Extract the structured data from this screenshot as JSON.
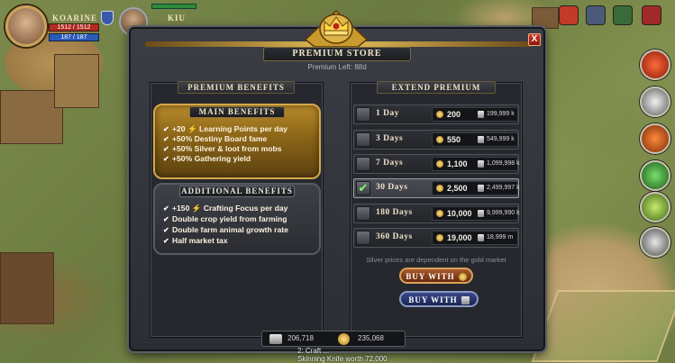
{
  "hud": {
    "player_name": "KOARINE",
    "health": "1512 / 1512",
    "energy": "187 / 187",
    "party_member": "KIU"
  },
  "window": {
    "title": "PREMIUM STORE",
    "premium_left": "Premium Left: 88d",
    "close_label": "X"
  },
  "benefits": {
    "header": "PREMIUM BENEFITS",
    "main_title": "MAIN BENEFITS",
    "main_items": [
      "+20 ⚡ Learning Points per day",
      "+50% Destiny Board fame",
      "+50% Silver & loot from mobs",
      "+50% Gathering yield"
    ],
    "additional_title": "ADDITIONAL BENEFITS",
    "additional_items": [
      "+150 ⚡ Crafting Focus per day",
      "Double crop yield from farming",
      "Double farm animal growth rate",
      "Half market tax"
    ]
  },
  "extend": {
    "header": "EXTEND PREMIUM",
    "packages": [
      {
        "days": "1 Day",
        "gold": "200",
        "silver": "199,999 k",
        "selected": false
      },
      {
        "days": "3 Days",
        "gold": "550",
        "silver": "549,999 k",
        "selected": false
      },
      {
        "days": "7 Days",
        "gold": "1,100",
        "silver": "1,099,998 k",
        "selected": false
      },
      {
        "days": "30 Days",
        "gold": "2,500",
        "silver": "2,499,997 k",
        "selected": true
      },
      {
        "days": "180 Days",
        "gold": "10,000",
        "silver": "9,999,990 k",
        "selected": false
      },
      {
        "days": "360 Days",
        "gold": "19,000",
        "silver": "18,999 m",
        "selected": false
      }
    ],
    "note": "Silver prices are dependent on the gold market",
    "buy_gold_label": "BUY WITH",
    "buy_silver_label": "BUY WITH"
  },
  "currency": {
    "silver": "206,718",
    "gold": "235,068"
  },
  "world": {
    "craft_line1": "2: Craft ...",
    "craft_line2": "Skinning Knife worth 72,000"
  },
  "colors": {
    "gold_accent": "#d4a84a",
    "panel_bg": "#26282d",
    "selected_check": "#7dff6a"
  },
  "icons": [
    "crown-icon",
    "close-icon",
    "check-icon",
    "gold-coin-icon",
    "silver-icon",
    "shield-icon"
  ]
}
